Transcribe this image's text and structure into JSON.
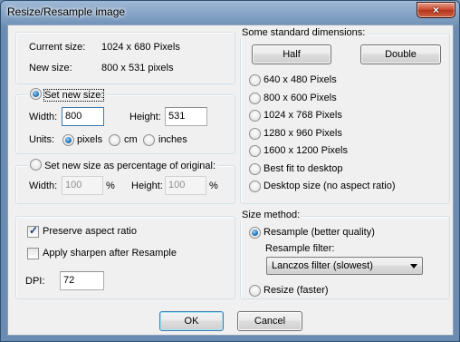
{
  "window": {
    "title": "Resize/Resample image",
    "close_glyph": "×"
  },
  "info": {
    "current_label": "Current size:",
    "current_value": "1024  x  680  Pixels",
    "new_label": "New size:",
    "new_value": "800  x  531  pixels"
  },
  "set_new_size": {
    "label": "Set new size:",
    "width_label": "Width:",
    "width_value": "800",
    "height_label": "Height:",
    "height_value": "531",
    "units_label": "Units:",
    "units": [
      "pixels",
      "cm",
      "inches"
    ]
  },
  "percentage": {
    "label": "Set new size as percentage of original:",
    "width_label": "Width:",
    "width_value": "100",
    "height_label": "Height:",
    "height_value": "100",
    "pct": "%"
  },
  "options": {
    "preserve_label": "Preserve aspect ratio",
    "preserve_checked": true,
    "sharpen_label": "Apply sharpen after Resample",
    "sharpen_checked": false,
    "dpi_label": "DPI:",
    "dpi_value": "72"
  },
  "standard": {
    "legend": "Some standard dimensions:",
    "half_label": "Half",
    "double_label": "Double",
    "sizes": [
      "640 x 480 Pixels",
      "800 x 600 Pixels",
      "1024 x 768 Pixels",
      "1280 x 960 Pixels",
      "1600 x 1200 Pixels",
      "Best fit to desktop",
      "Desktop size (no aspect ratio)"
    ]
  },
  "method": {
    "legend": "Size method:",
    "resample_label": "Resample (better quality)",
    "filter_label": "Resample filter:",
    "filter_value": "Lanczos filter (slowest)",
    "resize_label": "Resize (faster)"
  },
  "footer": {
    "ok_label": "OK",
    "cancel_label": "Cancel"
  },
  "colors": {
    "accent": "#2273b8",
    "title_bar": "#7d9cc0",
    "close_button": "#c7462b"
  }
}
